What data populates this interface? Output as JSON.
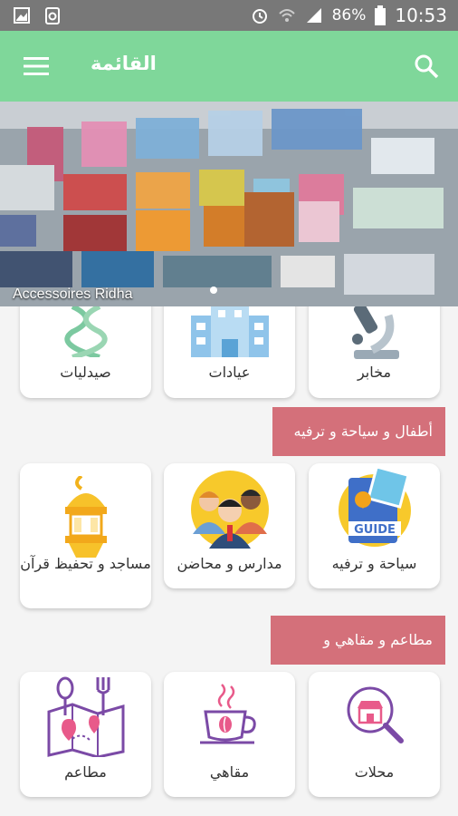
{
  "status_bar": {
    "battery": "86%",
    "time": "10:53",
    "icons": [
      "image-icon",
      "recycle-icon",
      "alarm-icon",
      "wifi-icon",
      "signal-icon",
      "battery-icon"
    ]
  },
  "app_bar": {
    "title": "القائمة",
    "menu_icon": "hamburger-icon",
    "search_icon": "search-icon",
    "color": "#7fd79a"
  },
  "banner": {
    "caption": "Accessoires Ridha"
  },
  "top_row": [
    {
      "label": "صيدليات",
      "icon": "dna-icon"
    },
    {
      "label": "عيادات",
      "icon": "hospital-icon"
    },
    {
      "label": "مخابر",
      "icon": "microscope-icon"
    }
  ],
  "section_kids": {
    "title": "أطفال و سياحة و ترفيه",
    "items": [
      {
        "label": "مساجد و تحفيظ قرآن",
        "icon": "lantern-icon"
      },
      {
        "label": "مدارس و محاضن",
        "icon": "students-icon"
      },
      {
        "label": "سياحة و ترفيه",
        "icon": "guide-book-icon",
        "badge": "GUIDE"
      }
    ]
  },
  "section_food": {
    "title": "مطاعم و مقاهي و محلات",
    "items": [
      {
        "label": "مطاعم",
        "icon": "restaurant-map-icon"
      },
      {
        "label": "مقاهي",
        "icon": "coffee-cup-icon"
      },
      {
        "label": "محلات",
        "icon": "shop-search-icon"
      }
    ]
  },
  "colors": {
    "section": "#d4707a",
    "appbar": "#7fd79a"
  }
}
